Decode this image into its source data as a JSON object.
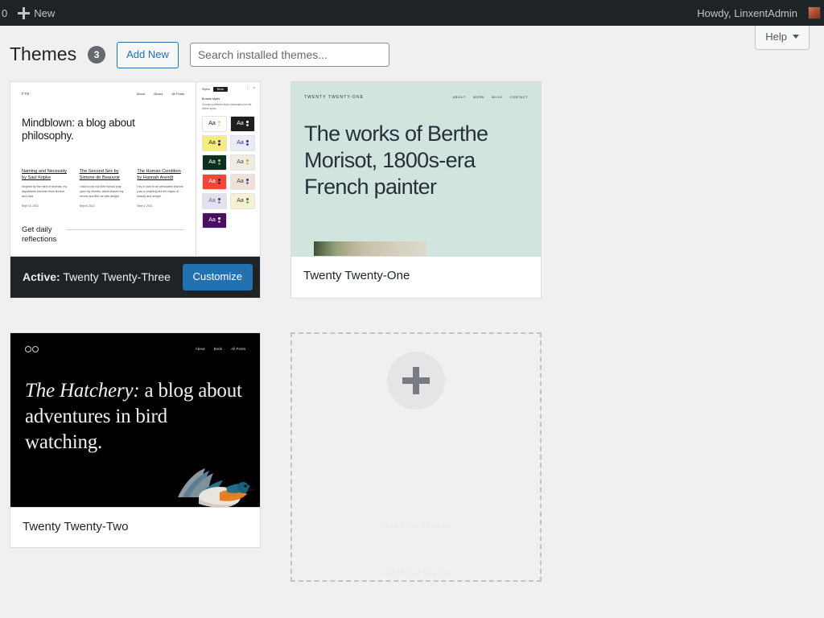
{
  "adminbar": {
    "comment_count": "0",
    "new_label": "New",
    "howdy": "Howdy, LinxentAdmin"
  },
  "help_tab": {
    "label": "Help"
  },
  "header": {
    "title": "Themes",
    "count": "3",
    "add_new_label": "Add New",
    "search_placeholder": "Search installed themes...",
    "search_value": ""
  },
  "colors": {
    "accent_blue": "#2271b1",
    "adminbar_dark": "#1d2327",
    "page_bg": "#f0f0f1",
    "tt1_bg": "#d1e4dd",
    "tt2_bg": "#000000"
  },
  "themes": [
    {
      "name": "Twenty Twenty-Three",
      "is_active": true,
      "active_prefix": "Active:",
      "customize_label": "Customize",
      "preview": {
        "logo": "FTB",
        "nav": [
          "About",
          "Books",
          "All Posts"
        ],
        "hero": "Mindblown: a blog about philosophy.",
        "posts": [
          {
            "title": "Naming and Necessity by Saul Kripke",
            "excerpt": "Inspired by the mind of aromas, my daydreams become more fervent and vivid.",
            "date": "Sept 16, 2021"
          },
          {
            "title": "The Second Sex by Simone de Beauvoir",
            "excerpt": "I had a cold not then furious play upon my cheeks, which braces my nerves and fills me with delight.",
            "date": "Sept 8, 2021"
          },
          {
            "title": "The Human Condition by Hannah Arendt",
            "excerpt": "I try in vain to be persuaded that the pole is anything but the region of beauty and delight.",
            "date": "Sept 4, 2021"
          }
        ],
        "cta": "Get daily\nreflections",
        "panel": {
          "tab_left": "Styles",
          "tab_right": "Block",
          "section": "Browse styles",
          "description": "Choose a different style combination for the theme styles.",
          "swatch_label": "Aa",
          "swatches": [
            {
              "bg": "#ffffff",
              "fg": "#1a1a1a",
              "dots": [
                "#c9d98a",
                "#e4e9c4"
              ]
            },
            {
              "bg": "#1e1e1e",
              "fg": "#ffffff",
              "dots": [
                "#ffffff",
                "#cfcfcf"
              ]
            },
            {
              "bg": "#f9ec7e",
              "fg": "#1a1a1a",
              "dots": [
                "#2f2f9e",
                "#1e1e1e"
              ]
            },
            {
              "bg": "#e9ecf7",
              "fg": "#2f2f9e",
              "dots": [
                "#2f2f9e",
                "#4a4ad4"
              ]
            },
            {
              "bg": "#0e2f1f",
              "fg": "#ffffff",
              "dots": [
                "#9fd67a",
                "#5aa14a"
              ]
            },
            {
              "bg": "#efece2",
              "fg": "#4a4a4a",
              "dots": [
                "#c4a24a",
                "#e0c77a"
              ]
            },
            {
              "bg": "#f2463a",
              "fg": "#ffffff",
              "dots": [
                "#1e1e1e",
                "#7a1c14"
              ]
            },
            {
              "bg": "#efe0d8",
              "fg": "#4a3a34",
              "dots": [
                "#2f2f9e",
                "#6a6ad4"
              ]
            },
            {
              "bg": "#e4e1ef",
              "fg": "#6a6a8a",
              "dots": [
                "#3a3a6a",
                "#8a8ab4"
              ]
            },
            {
              "bg": "#f7f2d4",
              "fg": "#3a3a2a",
              "dots": [
                "#2f7a4a",
                "#6ab47a"
              ]
            },
            {
              "bg": "#4a1060",
              "fg": "#ffffff",
              "dots": [
                "#ffffff",
                "#c49ad4"
              ]
            }
          ]
        }
      }
    },
    {
      "name": "Twenty Twenty-One",
      "is_active": false,
      "preview": {
        "brand": "TWENTY TWENTY-ONE",
        "nav": [
          "ABOUT",
          "WORK",
          "BLOG",
          "CONTACT"
        ],
        "hero": "The works of Berthe Morisot, 1800s-era French painter"
      }
    },
    {
      "name": "Twenty Twenty-Two",
      "is_active": false,
      "preview": {
        "logo_icon": "binoculars-icon",
        "nav": [
          "About",
          "Birds",
          "All Posts"
        ],
        "hero_emphasis": "The Hatchery:",
        "hero_rest": " a blog about adventures in bird watching."
      }
    }
  ],
  "add_theme": {
    "label": "Add New Theme",
    "label_secondary": "Add New Theme",
    "icon": "plus-icon"
  }
}
